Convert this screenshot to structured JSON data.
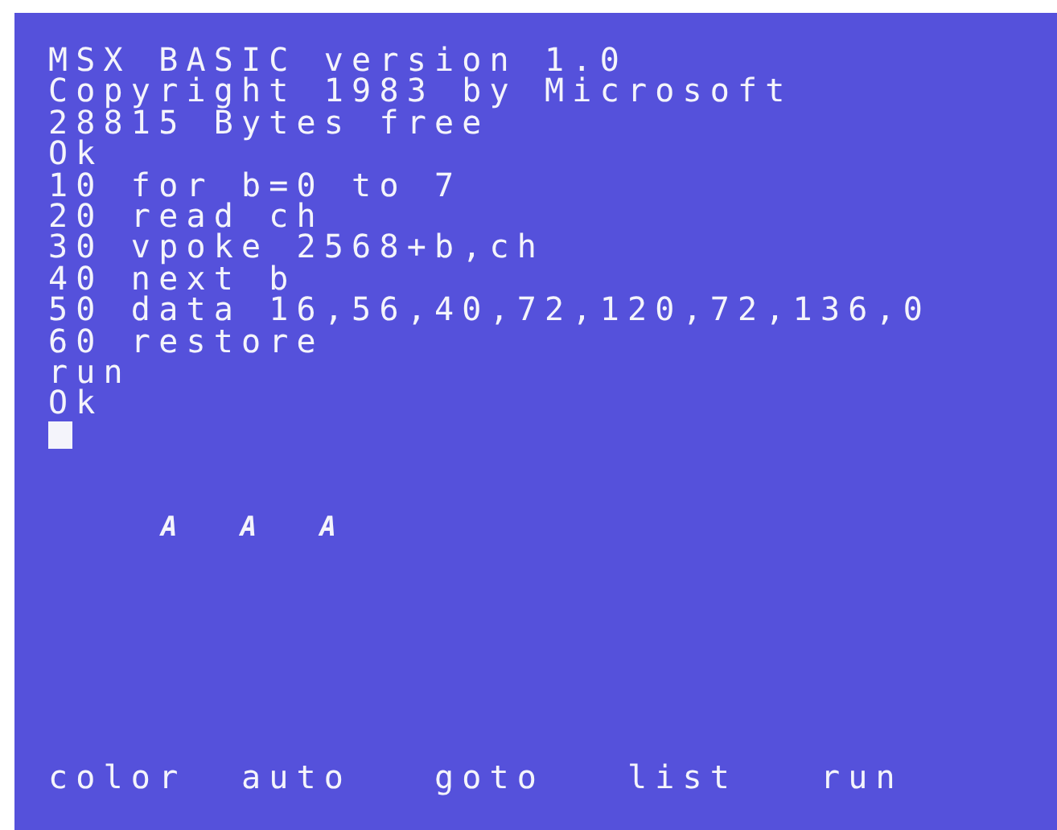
{
  "screen": {
    "lines": [
      "MSX BASIC version 1.0",
      "Copyright 1983 by Microsoft",
      "28815 Bytes free",
      "Ok",
      "10 for b=0 to 7",
      "20 read ch",
      "30 vpoke 2568+b,ch",
      "40 next b",
      "50 data 16,56,40,72,120,72,136,0",
      "60 restore",
      "run",
      "Ok"
    ],
    "cursor": {
      "visible": true
    },
    "custom_chars": [
      "A",
      "A",
      "A"
    ],
    "function_keys": [
      "color",
      "auto",
      "goto",
      "list",
      "run"
    ]
  }
}
